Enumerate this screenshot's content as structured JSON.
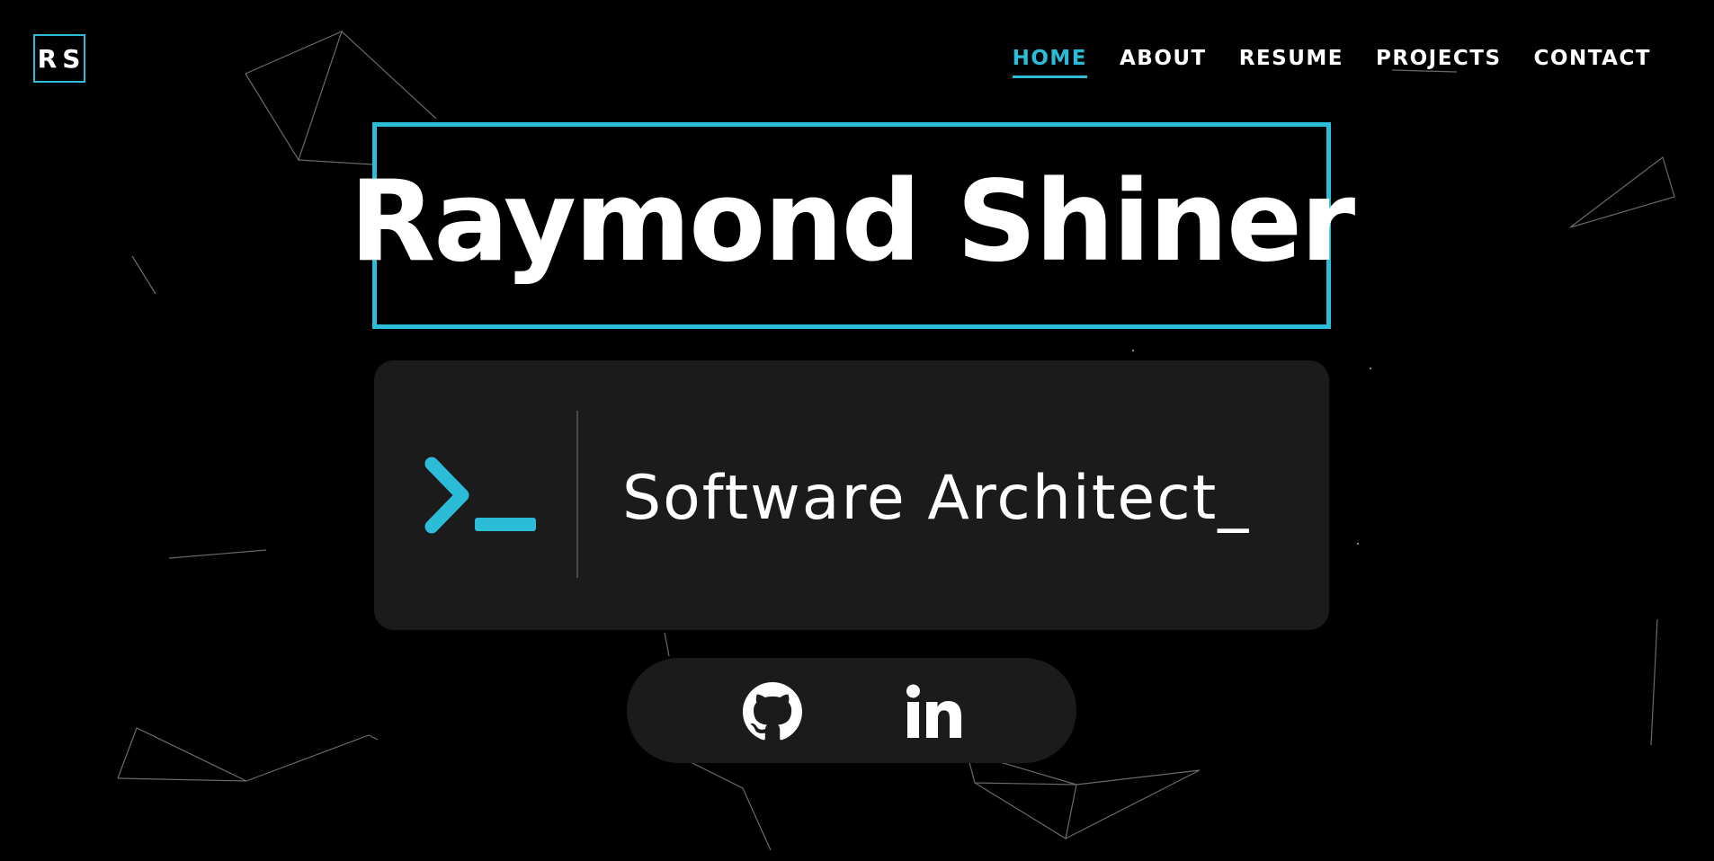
{
  "header": {
    "logo_text": "RS",
    "nav": [
      {
        "label": "HOME",
        "active": true
      },
      {
        "label": "ABOUT",
        "active": false
      },
      {
        "label": "RESUME",
        "active": false
      },
      {
        "label": "PROJECTS",
        "active": false
      },
      {
        "label": "CONTACT",
        "active": false
      }
    ]
  },
  "hero": {
    "name": "Raymond Shiner",
    "role": "Software Architect_",
    "role_icon": "terminal-prompt-icon"
  },
  "social": [
    {
      "icon": "github-icon",
      "label": "GitHub"
    },
    {
      "icon": "linkedin-icon",
      "label": "LinkedIn"
    }
  ],
  "colors": {
    "accent": "#2bbcd8",
    "background": "#000000",
    "card": "#1b1b1b",
    "text": "#ffffff"
  }
}
